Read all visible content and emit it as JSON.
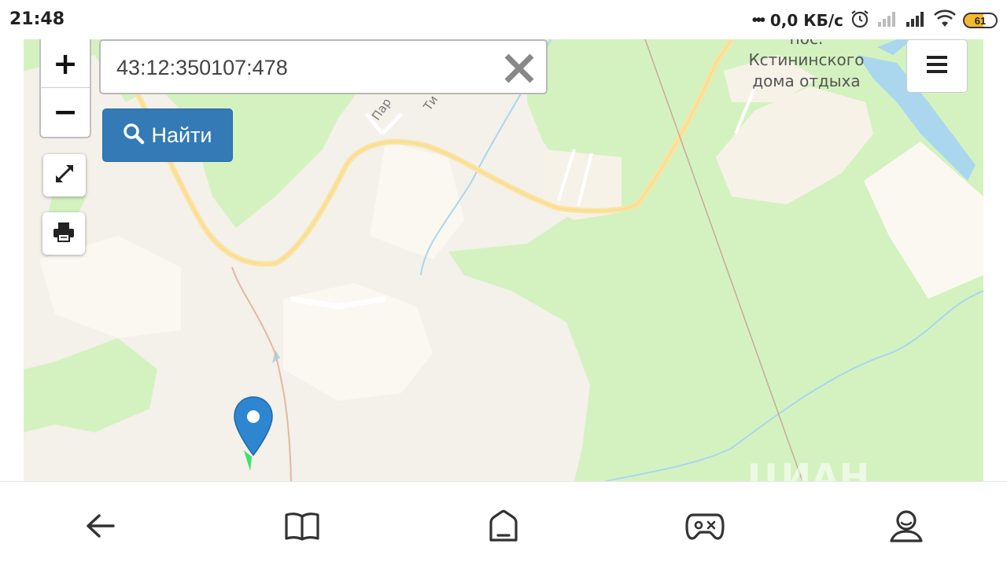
{
  "status_bar": {
    "time": "21:48",
    "dots": "•••",
    "network_speed": "0,0 КБ/с",
    "battery_level": "61",
    "battery_fraction": 0.61,
    "battery_color": "#f5b82e"
  },
  "map": {
    "place_label": "пос.\nКстининского\nдома отдыха",
    "street_label_1": "Пар",
    "street_label_2": "Ти",
    "watermark": "ЦИАН",
    "colors": {
      "background": "#f4f0ea",
      "forest": "#d4f2c0",
      "field": "#fbf8f1",
      "road": "#fbe3a0",
      "water": "#aad7ee",
      "marker": "#2f86d0"
    }
  },
  "controls": {
    "zoom_in": "+",
    "zoom_out": "−",
    "fullscreen_icon": "expand-icon",
    "print_icon": "printer-icon",
    "menu_icon": "hamburger-icon"
  },
  "search": {
    "value": "43:12:350107:478",
    "placeholder": "",
    "clear_icon": "close-icon",
    "button_label": "Найти",
    "button_icon": "search-icon",
    "button_color": "#337ab7"
  },
  "bottom_nav": {
    "items": [
      "back-arrow-icon",
      "book-icon",
      "home-icon",
      "gamepad-icon",
      "profile-icon"
    ]
  }
}
